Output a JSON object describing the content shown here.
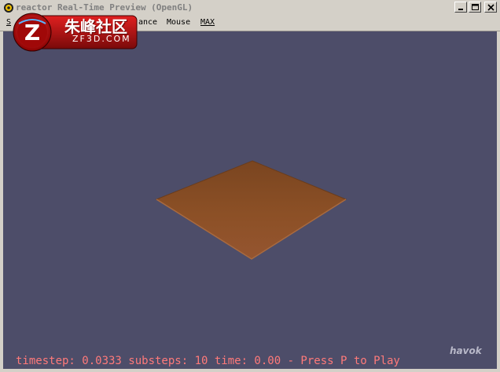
{
  "window": {
    "title": "reactor Real-Time Preview (OpenGL)",
    "controls": {
      "minimize": "_",
      "maximize": "□",
      "close": "✕"
    }
  },
  "menu": {
    "items": [
      {
        "prefix": "S",
        "label": "S"
      },
      {
        "label": "ance"
      },
      {
        "label": "Mouse"
      },
      {
        "label": "MAX"
      }
    ]
  },
  "viewport": {
    "background": "#4d4d69",
    "plane_color": "#8a4e22",
    "status": "timestep: 0.0333 substeps: 10 time: 0.00 - Press P to Play",
    "logo": "havok"
  },
  "watermark": {
    "cn": "朱峰社区",
    "en": "ZF3D.COM",
    "badge_letter": "Z"
  }
}
